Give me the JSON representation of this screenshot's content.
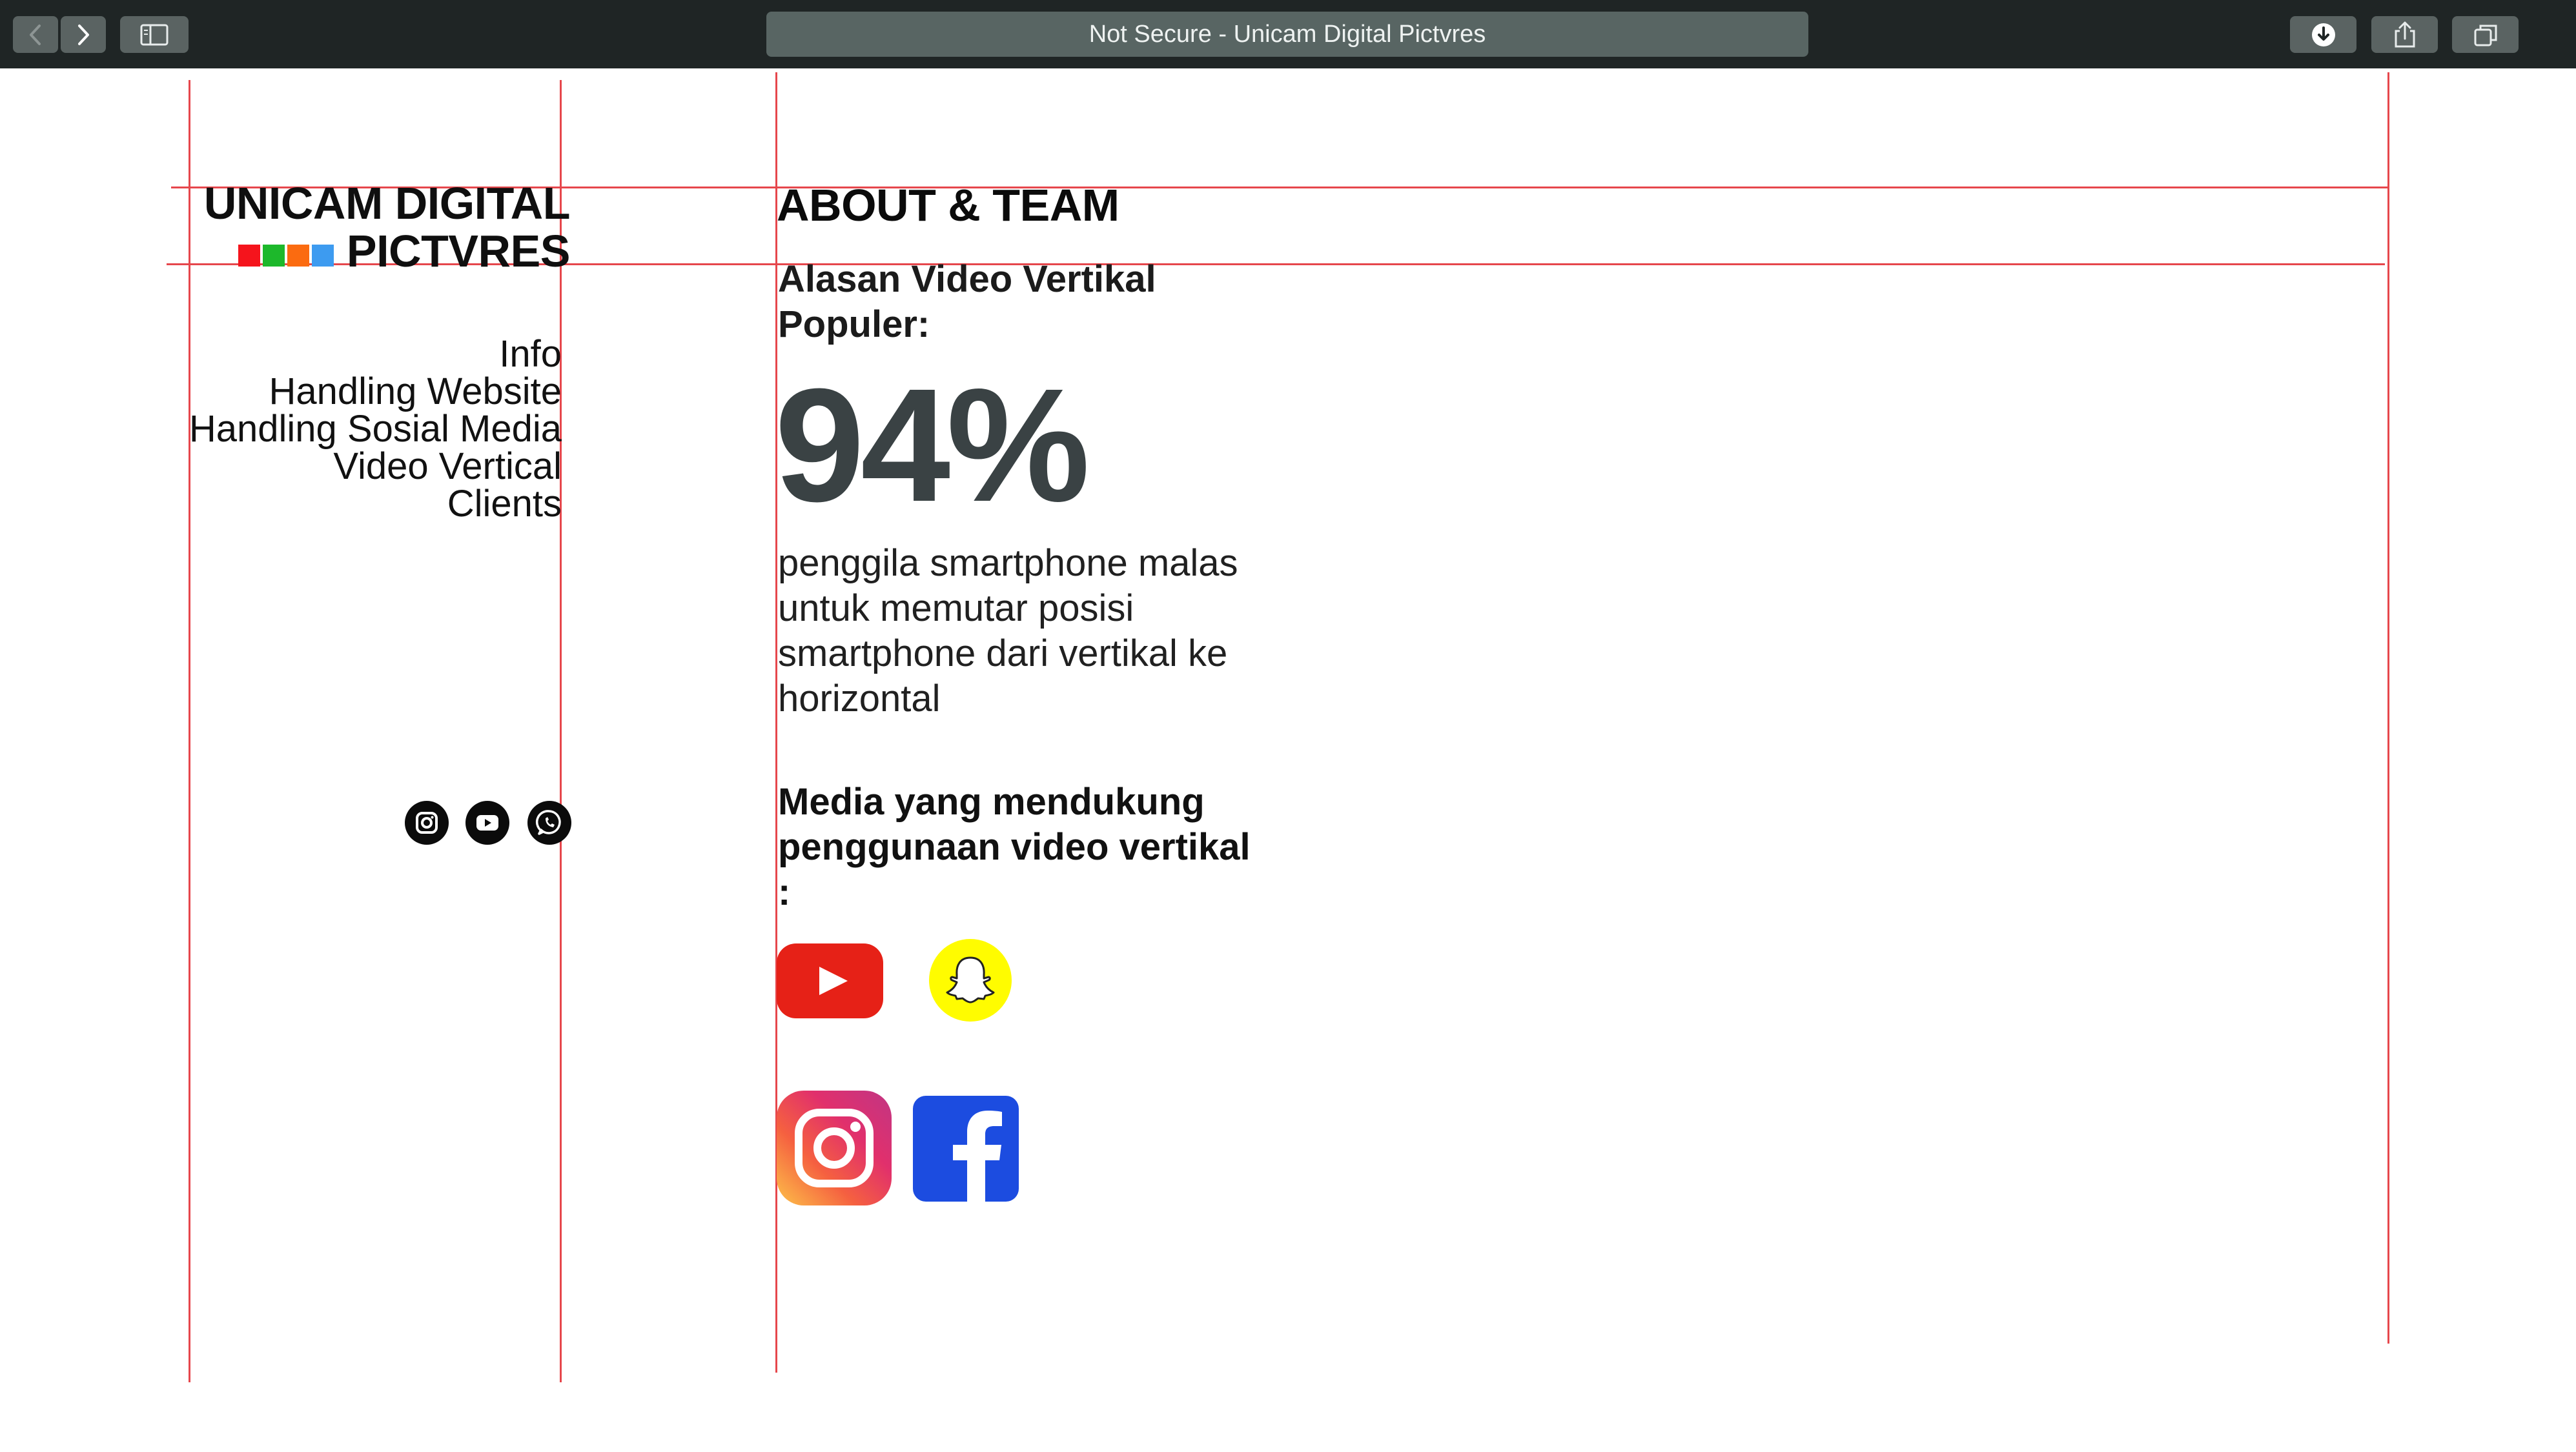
{
  "browser": {
    "address_text": "Not Secure - Unicam Digital Pictvres",
    "back_icon": "chevron-left-icon",
    "forward_icon": "chevron-right-icon",
    "sidebar_icon": "sidebar-icon",
    "download_icon": "download-icon",
    "share_icon": "share-icon",
    "tabs_icon": "tabs-icon"
  },
  "brand": {
    "line1": "UNICAM DIGITAL",
    "line2": "PICTVRES",
    "swatch_colors": [
      "#f5141c",
      "#1db82b",
      "#fb6b10",
      "#3d9bf0"
    ]
  },
  "nav": {
    "items": [
      "Info",
      "Handling Website",
      "Handling Sosial Media",
      "Video Vertical",
      "Clients"
    ]
  },
  "social": {
    "icons": [
      "instagram-icon",
      "youtube-icon",
      "whatsapp-icon"
    ]
  },
  "main": {
    "heading": "ABOUT & TEAM",
    "subheading": "Alasan Video Vertikal Populer:",
    "stat": "94%",
    "stat_description": "penggila smartphone malas untuk memutar posisi smartphone dari vertikal ke horizontal",
    "media_heading": "Media yang mendukung penggunaan video vertikal :",
    "media_logos": [
      "youtube-logo",
      "snapchat-logo",
      "instagram-logo",
      "facebook-logo"
    ]
  },
  "colors": {
    "toolbar_bg": "#1f2525",
    "guide_line": "#e6474c",
    "stat_color": "#3a4244",
    "youtube_red": "#e62117",
    "snapchat_yellow": "#fffc00",
    "facebook_blue": "#1c4ce0"
  }
}
